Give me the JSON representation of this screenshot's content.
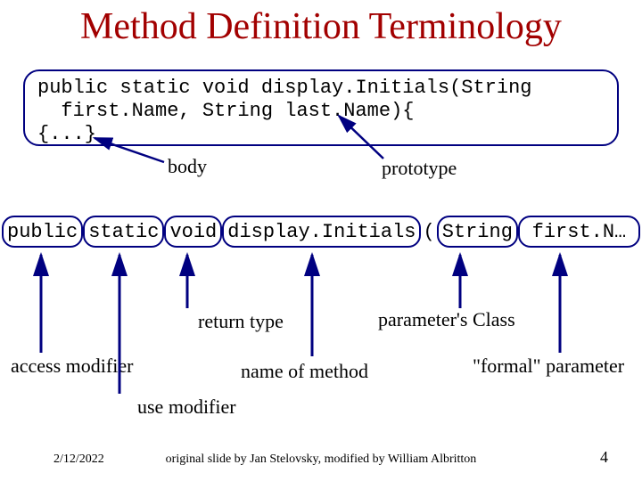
{
  "title": "Method Definition Terminology",
  "code": {
    "line1": "public static void display.Initials(String",
    "line2": "  first.Name, String last.Name){",
    "line3": "{...}"
  },
  "labels": {
    "body": "body",
    "prototype": "prototype",
    "return_type": "return type",
    "param_class": "parameter's Class",
    "access_modifier": "access modifier",
    "name_of_method": "name of method",
    "formal_parameter": "\"formal\" parameter",
    "use_modifier": "use modifier"
  },
  "signature": {
    "public": "public",
    "static": "static",
    "void": "void",
    "method": "display.Initials",
    "lparen": "(",
    "type": "String",
    "param": "first.N…"
  },
  "footer": {
    "date": "2/12/2022",
    "credit": "original slide by Jan Stelovsky, modified by William Albritton",
    "page": "4"
  }
}
